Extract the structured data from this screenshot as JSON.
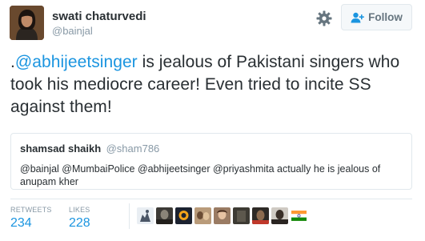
{
  "author": {
    "name": "swati chaturvedi",
    "handle": "@bainjal"
  },
  "follow_button": {
    "label": "Follow",
    "icon": "follow-person-plus-icon"
  },
  "settings_icon": "gear-icon",
  "tweet": {
    "text_prefix": ".",
    "mention": "@abhijeetsinger",
    "text_body": " is jealous of Pakistani singers who took his mediocre career! Even tried to incite SS against them!"
  },
  "quoted_tweet": {
    "name": "shamsad shaikh",
    "handle": "@sham786",
    "text": "@bainjal @MumbaiPolice @abhijeetsinger @priyashmita actually he is jealous of anupam kher"
  },
  "stats": {
    "retweets_label": "RETWEETS",
    "retweets_value": "234",
    "likes_label": "LIKES",
    "likes_value": "228"
  },
  "likers": [
    {
      "name": "liker-avatar-1",
      "color": "#e9eef3"
    },
    {
      "name": "liker-avatar-2",
      "color": "#3c3a36"
    },
    {
      "name": "liker-avatar-3",
      "color": "#1c2230"
    },
    {
      "name": "liker-avatar-4",
      "color": "#b99b7a"
    },
    {
      "name": "liker-avatar-5",
      "color": "#9a7b63"
    },
    {
      "name": "liker-avatar-6",
      "color": "#3d3a33"
    },
    {
      "name": "liker-avatar-7",
      "color": "#2e2a26"
    },
    {
      "name": "liker-avatar-8",
      "color": "#cfcac3"
    },
    {
      "name": "liker-avatar-9",
      "color": "#ffffff"
    }
  ],
  "colors": {
    "link": "#1b95e0",
    "text": "#292f33",
    "muted": "#8899a6",
    "border": "#e1e8ed"
  }
}
